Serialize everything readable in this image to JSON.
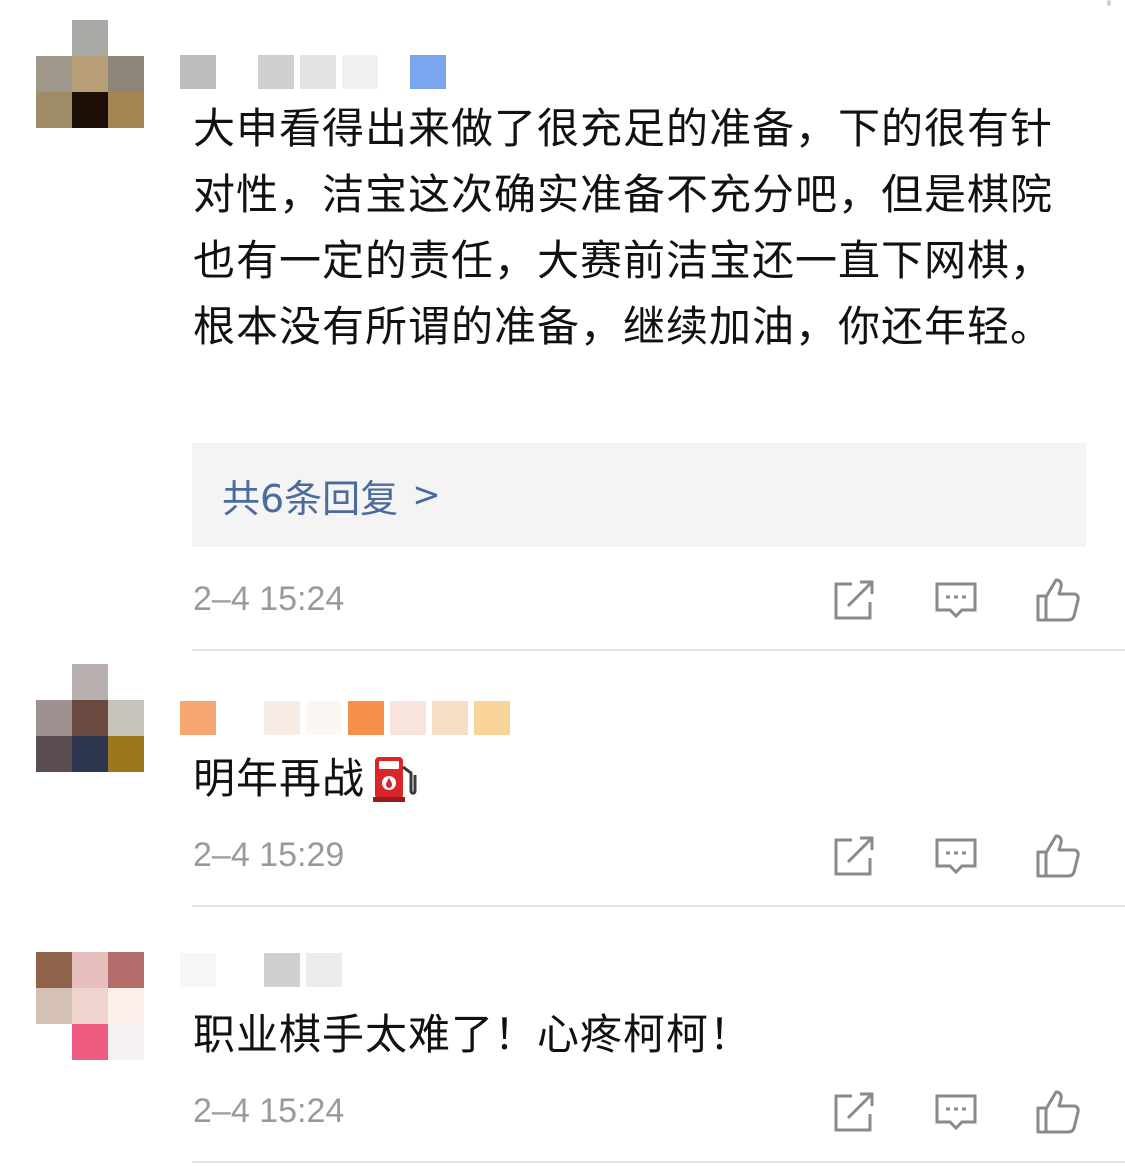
{
  "comments": [
    {
      "text": "大申看得出来做了很充足的准备，下的很有针对性，洁宝这次确实准备不充分吧，但是棋院也有一定的责任，大赛前洁宝还一直下网棋，根本没有所谓的准备，继续加油，你还年轻。",
      "reply_count_label": "共6条回复",
      "reply_chevron": ">",
      "timestamp": "2–4 15:24"
    },
    {
      "text": "明年再战",
      "emoji": "fuel-pump-emoji",
      "timestamp": "2–4 15:29"
    },
    {
      "text": "职业棋手太难了！心疼柯柯！",
      "timestamp": "2–4 15:24"
    }
  ],
  "icons": {
    "repost": "repost-icon",
    "comment": "comment-icon",
    "like": "like-icon"
  },
  "colors": {
    "text": "#111111",
    "link": "#4a6b9b",
    "meta": "#9a9a9a",
    "icon": "#8a8a8a",
    "reply_bg": "#f4f4f5",
    "divider": "#e6e6e6"
  }
}
